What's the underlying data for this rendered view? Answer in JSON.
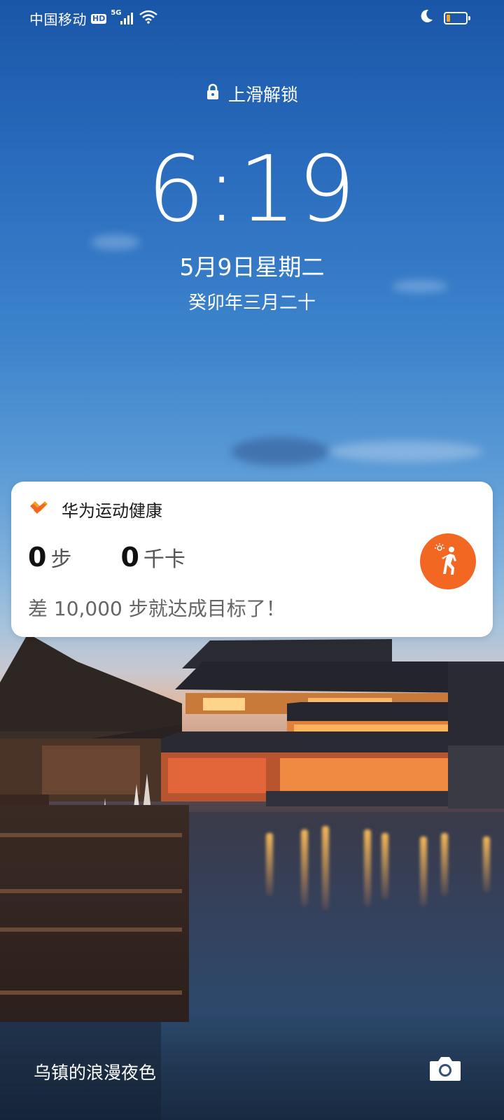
{
  "status_bar": {
    "carrier": "中国移动",
    "hd_badge": "HD",
    "network": "5G",
    "icons": [
      "signal-icon",
      "wifi-icon",
      "moon-icon",
      "battery-icon"
    ],
    "battery_level": 0.2,
    "battery_color": "#f5a623"
  },
  "lock": {
    "unlock_hint": "上滑解锁",
    "time": "6:19",
    "date": "5月9日星期二",
    "lunar_date": "癸卯年三月二十"
  },
  "health_card": {
    "app_name": "华为运动健康",
    "steps_value": "0",
    "steps_unit": "步",
    "calories_value": "0",
    "calories_unit": "千卡",
    "goal_text": "差 10,000 步就达成目标了！",
    "accent_color": "#f26722"
  },
  "wallpaper": {
    "caption": "乌镇的浪漫夜色"
  }
}
